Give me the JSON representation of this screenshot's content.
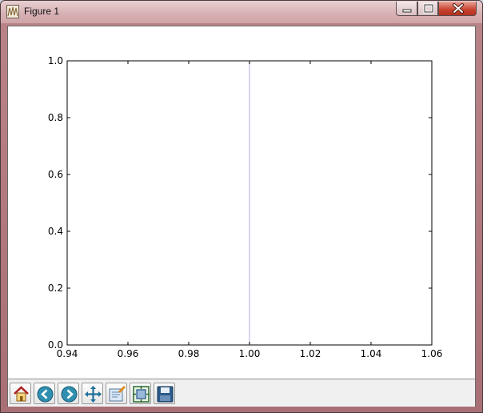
{
  "window": {
    "title": "Figure 1"
  },
  "toolbar": {
    "buttons": [
      {
        "name": "home",
        "icon": "home-icon"
      },
      {
        "name": "back",
        "icon": "back-arrow-icon"
      },
      {
        "name": "forward",
        "icon": "forward-arrow-icon"
      },
      {
        "name": "pan",
        "icon": "pan-arrows-icon"
      },
      {
        "name": "zoom",
        "icon": "zoom-rectangle-icon"
      },
      {
        "name": "configure-subplots",
        "icon": "subplots-icon"
      },
      {
        "name": "save",
        "icon": "save-floppy-icon"
      }
    ]
  },
  "chart_data": {
    "type": "line",
    "title": "",
    "xlabel": "",
    "ylabel": "",
    "xlim": [
      0.94,
      1.06
    ],
    "ylim": [
      0.0,
      1.0
    ],
    "xticks": [
      "0.94",
      "0.96",
      "0.98",
      "1.00",
      "1.02",
      "1.04",
      "1.06"
    ],
    "yticks": [
      "0.0",
      "0.2",
      "0.4",
      "0.6",
      "0.8",
      "1.0"
    ],
    "grid": false,
    "series": [
      {
        "x": [
          1.0,
          1.0
        ],
        "y": [
          0.0,
          1.0
        ],
        "color": "#c8c8f0"
      }
    ]
  }
}
